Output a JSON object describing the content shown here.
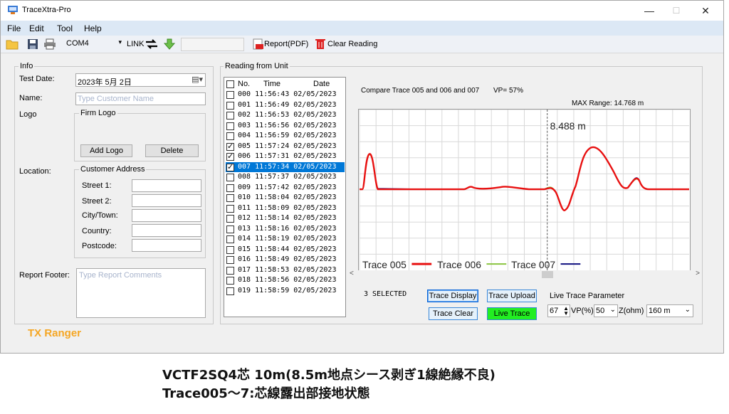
{
  "window": {
    "title": "TraceXtra-Pro",
    "minimize": "—",
    "maximize": "☐",
    "close": "✕"
  },
  "menu": [
    "File",
    "Edit",
    "Tool",
    "Help"
  ],
  "toolbar": {
    "port": "COM4",
    "link": "LINK",
    "report_label": "Report(PDF)",
    "clear_label": "Clear Reading"
  },
  "info": {
    "group_title": "Info",
    "test_date_label": "Test Date:",
    "test_date_value": "2023年 5月 2日",
    "name_label": "Name:",
    "name_placeholder": "Type Customer Name",
    "logo_label": "Logo",
    "firm_logo_title": "Firm Logo",
    "add_logo": "Add Logo",
    "delete": "Delete",
    "location_label": "Location:",
    "address_title": "Customer Address",
    "street1": "Street 1:",
    "street2": "Street 2:",
    "city": "City/Town:",
    "country": "Country:",
    "postcode": "Postcode:",
    "footer_label": "Report Footer:",
    "footer_placeholder": "Type Report Comments",
    "brand": "TX Ranger"
  },
  "reading": {
    "group_title": "Reading from Unit",
    "col_no": "No.",
    "col_time": "Time",
    "col_date": "Date",
    "rows": [
      {
        "no": "000",
        "time": "11:56:43",
        "date": "02/05/2023",
        "checked": false,
        "selected": false
      },
      {
        "no": "001",
        "time": "11:56:49",
        "date": "02/05/2023",
        "checked": false,
        "selected": false
      },
      {
        "no": "002",
        "time": "11:56:53",
        "date": "02/05/2023",
        "checked": false,
        "selected": false
      },
      {
        "no": "003",
        "time": "11:56:56",
        "date": "02/05/2023",
        "checked": false,
        "selected": false
      },
      {
        "no": "004",
        "time": "11:56:59",
        "date": "02/05/2023",
        "checked": false,
        "selected": false
      },
      {
        "no": "005",
        "time": "11:57:24",
        "date": "02/05/2023",
        "checked": true,
        "selected": false
      },
      {
        "no": "006",
        "time": "11:57:31",
        "date": "02/05/2023",
        "checked": true,
        "selected": false
      },
      {
        "no": "007",
        "time": "11:57:34",
        "date": "02/05/2023",
        "checked": true,
        "selected": true
      },
      {
        "no": "008",
        "time": "11:57:37",
        "date": "02/05/2023",
        "checked": false,
        "selected": false
      },
      {
        "no": "009",
        "time": "11:57:42",
        "date": "02/05/2023",
        "checked": false,
        "selected": false
      },
      {
        "no": "010",
        "time": "11:58:04",
        "date": "02/05/2023",
        "checked": false,
        "selected": false
      },
      {
        "no": "011",
        "time": "11:58:09",
        "date": "02/05/2023",
        "checked": false,
        "selected": false
      },
      {
        "no": "012",
        "time": "11:58:14",
        "date": "02/05/2023",
        "checked": false,
        "selected": false
      },
      {
        "no": "013",
        "time": "11:58:16",
        "date": "02/05/2023",
        "checked": false,
        "selected": false
      },
      {
        "no": "014",
        "time": "11:58:19",
        "date": "02/05/2023",
        "checked": false,
        "selected": false
      },
      {
        "no": "015",
        "time": "11:58:44",
        "date": "02/05/2023",
        "checked": false,
        "selected": false
      },
      {
        "no": "016",
        "time": "11:58:49",
        "date": "02/05/2023",
        "checked": false,
        "selected": false
      },
      {
        "no": "017",
        "time": "11:58:53",
        "date": "02/05/2023",
        "checked": false,
        "selected": false
      },
      {
        "no": "018",
        "time": "11:58:56",
        "date": "02/05/2023",
        "checked": false,
        "selected": false
      },
      {
        "no": "019",
        "time": "11:58:59",
        "date": "02/05/2023",
        "checked": false,
        "selected": false
      }
    ],
    "compare_text": "Compare Trace 005 and 006 and 007",
    "vp_text": "VP= 57%",
    "max_range": "MAX Range: 14.768 m",
    "cursor_label": "8.488 m",
    "legend": [
      {
        "name": "Trace 005",
        "color": "#e81010"
      },
      {
        "name": "Trace 006",
        "color": "#8ac540"
      },
      {
        "name": "Trace 007",
        "color": "#101080"
      }
    ],
    "selected_count": "3 SELECTED",
    "trace_display": "Trace Display",
    "trace_upload": "Trace Upload",
    "trace_clear": "Trace Clear",
    "live_trace": "Live Trace",
    "live_param_title": "Live Trace Parameter",
    "vp_value": "67",
    "vp_unit": "VP(%)",
    "z_value": "50",
    "z_unit": "Z(ohm)",
    "range_value": "160 m",
    "live_color": "#22ee22"
  },
  "caption": {
    "line1": "VCTF2SQ4芯 10m(8.5m地点シース剥ぎ1線絶縁不良)",
    "line2": "Trace005～7:芯線露出部接地状態"
  }
}
